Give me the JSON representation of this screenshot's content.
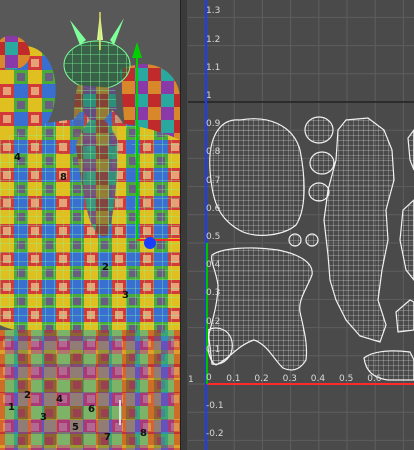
{
  "viewport": {
    "name": "3D perspective viewport",
    "checker_digits": [
      "1",
      "2",
      "3",
      "4",
      "5",
      "6",
      "7",
      "8"
    ],
    "colors": {
      "background": "#585858",
      "wire": "#7dff9a",
      "manip_y": "#00d000",
      "manip_z": "#1a3cff",
      "manip_x": "#ff2a2a"
    }
  },
  "uv_editor": {
    "name": "UV Texture Editor",
    "y_axis_labels": [
      {
        "text": "1.3",
        "v": 1.3
      },
      {
        "text": "1.2",
        "v": 1.2
      },
      {
        "text": "1.1",
        "v": 1.1
      },
      {
        "text": "1",
        "v": 1.0
      },
      {
        "text": "0.9",
        "v": 0.9
      },
      {
        "text": "0.8",
        "v": 0.8
      },
      {
        "text": "0.7",
        "v": 0.7
      },
      {
        "text": "0.6",
        "v": 0.6
      },
      {
        "text": "0.5",
        "v": 0.5
      },
      {
        "text": "0.4",
        "v": 0.4
      },
      {
        "text": "0.3",
        "v": 0.3
      },
      {
        "text": "0.2",
        "v": 0.2
      },
      {
        "text": "0.1",
        "v": 0.1
      },
      {
        "text": "0",
        "v": 0.0
      },
      {
        "text": "-0.1",
        "v": -0.1
      },
      {
        "text": "-0.2",
        "v": -0.2
      }
    ],
    "x_axis_labels": [
      {
        "text": "0.1",
        "u": 0.1
      },
      {
        "text": "0.2",
        "u": 0.2
      },
      {
        "text": "0.3",
        "u": 0.3
      },
      {
        "text": "0.4",
        "u": 0.4
      },
      {
        "text": "0.5",
        "u": 0.5
      },
      {
        "text": "0.6",
        "u": 0.6
      }
    ],
    "corner_label": "1",
    "colors": {
      "background": "#4a4a4a",
      "grid": "#5e5e5e",
      "grid_major": "#222222",
      "axis_u": "#ff2a2a",
      "axis_v": "#1a3cff",
      "uv_shell": "#f2f2f2"
    }
  }
}
